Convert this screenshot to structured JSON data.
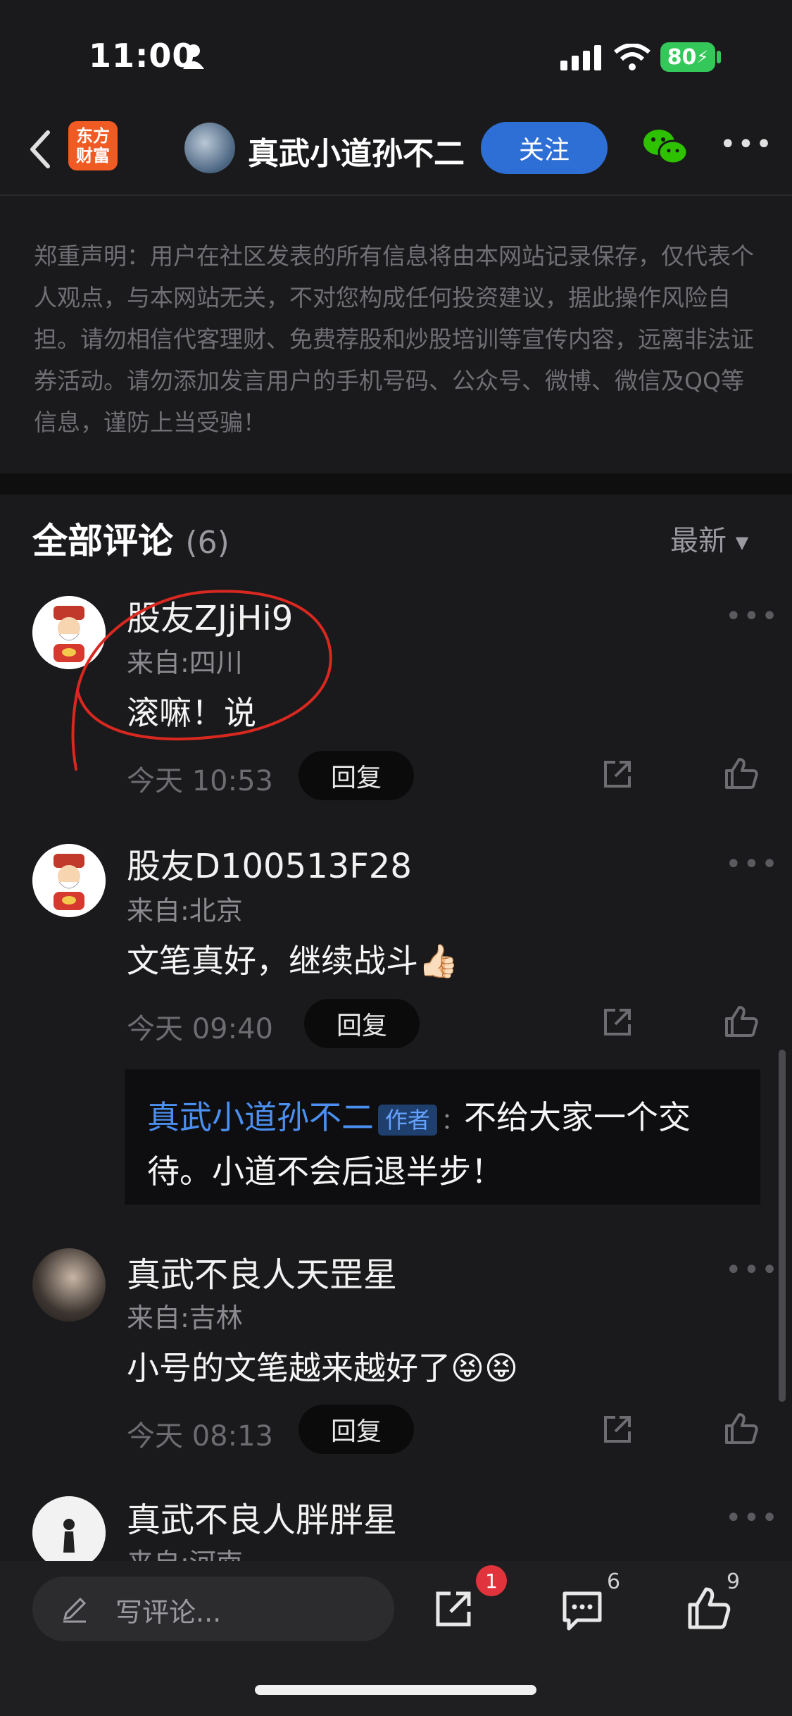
{
  "status_bar": {
    "time": "11:00",
    "battery": "80"
  },
  "header": {
    "back_icon": "chevron-left-icon",
    "app_logo": "东方\n财富",
    "title": "真武小道孙不二",
    "follow_label": "关注",
    "wechat_icon": "wechat-icon",
    "more_icon": "more-horizontal-icon"
  },
  "disclaimer": "郑重声明：用户在社区发表的所有信息将由本网站记录保存，仅代表个人观点，与本网站无关，不对您构成任何投资建议，据此操作风险自担。请勿相信代客理财、免费荐股和炒股培训等宣传内容，远离非法证券活动。请勿添加发言用户的手机号码、公众号、微博、微信及QQ等信息，谨防上当受骗！",
  "comments": {
    "title": "全部评论",
    "count": "(6)",
    "sort_label": "最新",
    "reply_label": "回复",
    "items": [
      {
        "name": "股友ZJjHi9",
        "location": "来自:四川",
        "text": "滚嘛！说",
        "time": "今天 10:53"
      },
      {
        "name": "股友D100513F28",
        "location": "来自:北京",
        "text": "文笔真好，继续战斗👍🏻",
        "time": "今天 09:40"
      },
      {
        "name": "真武不良人天罡星",
        "location": "来自:吉林",
        "text": "小号的文笔越来越好了😝😝",
        "time": "今天 08:13"
      },
      {
        "name": "真武不良人胖胖星",
        "location": "来自:河南"
      }
    ],
    "author_reply": {
      "author": "真武小道孙不二",
      "badge": "作者",
      "separator": "：",
      "text": "不给大家一个交待。小道不会后退半步！"
    }
  },
  "bottom_bar": {
    "input_placeholder": "写评论...",
    "share_badge": "1",
    "comment_count": "6",
    "like_count": "9"
  }
}
